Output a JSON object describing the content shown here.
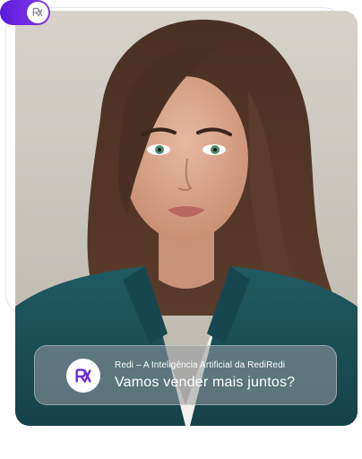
{
  "toggle": {
    "state": "on",
    "icon": "redi-logo-icon",
    "color": "#6c2be6"
  },
  "hero": {
    "image": "portrait-photo"
  },
  "caption": {
    "icon": "redi-logo-icon",
    "subtitle": "Redi – A Inteligência Artificial da RediRedi",
    "title": "Vamos vender mais juntos?"
  },
  "colors": {
    "accent": "#6c2be6",
    "logo": "#6a2bd8"
  }
}
